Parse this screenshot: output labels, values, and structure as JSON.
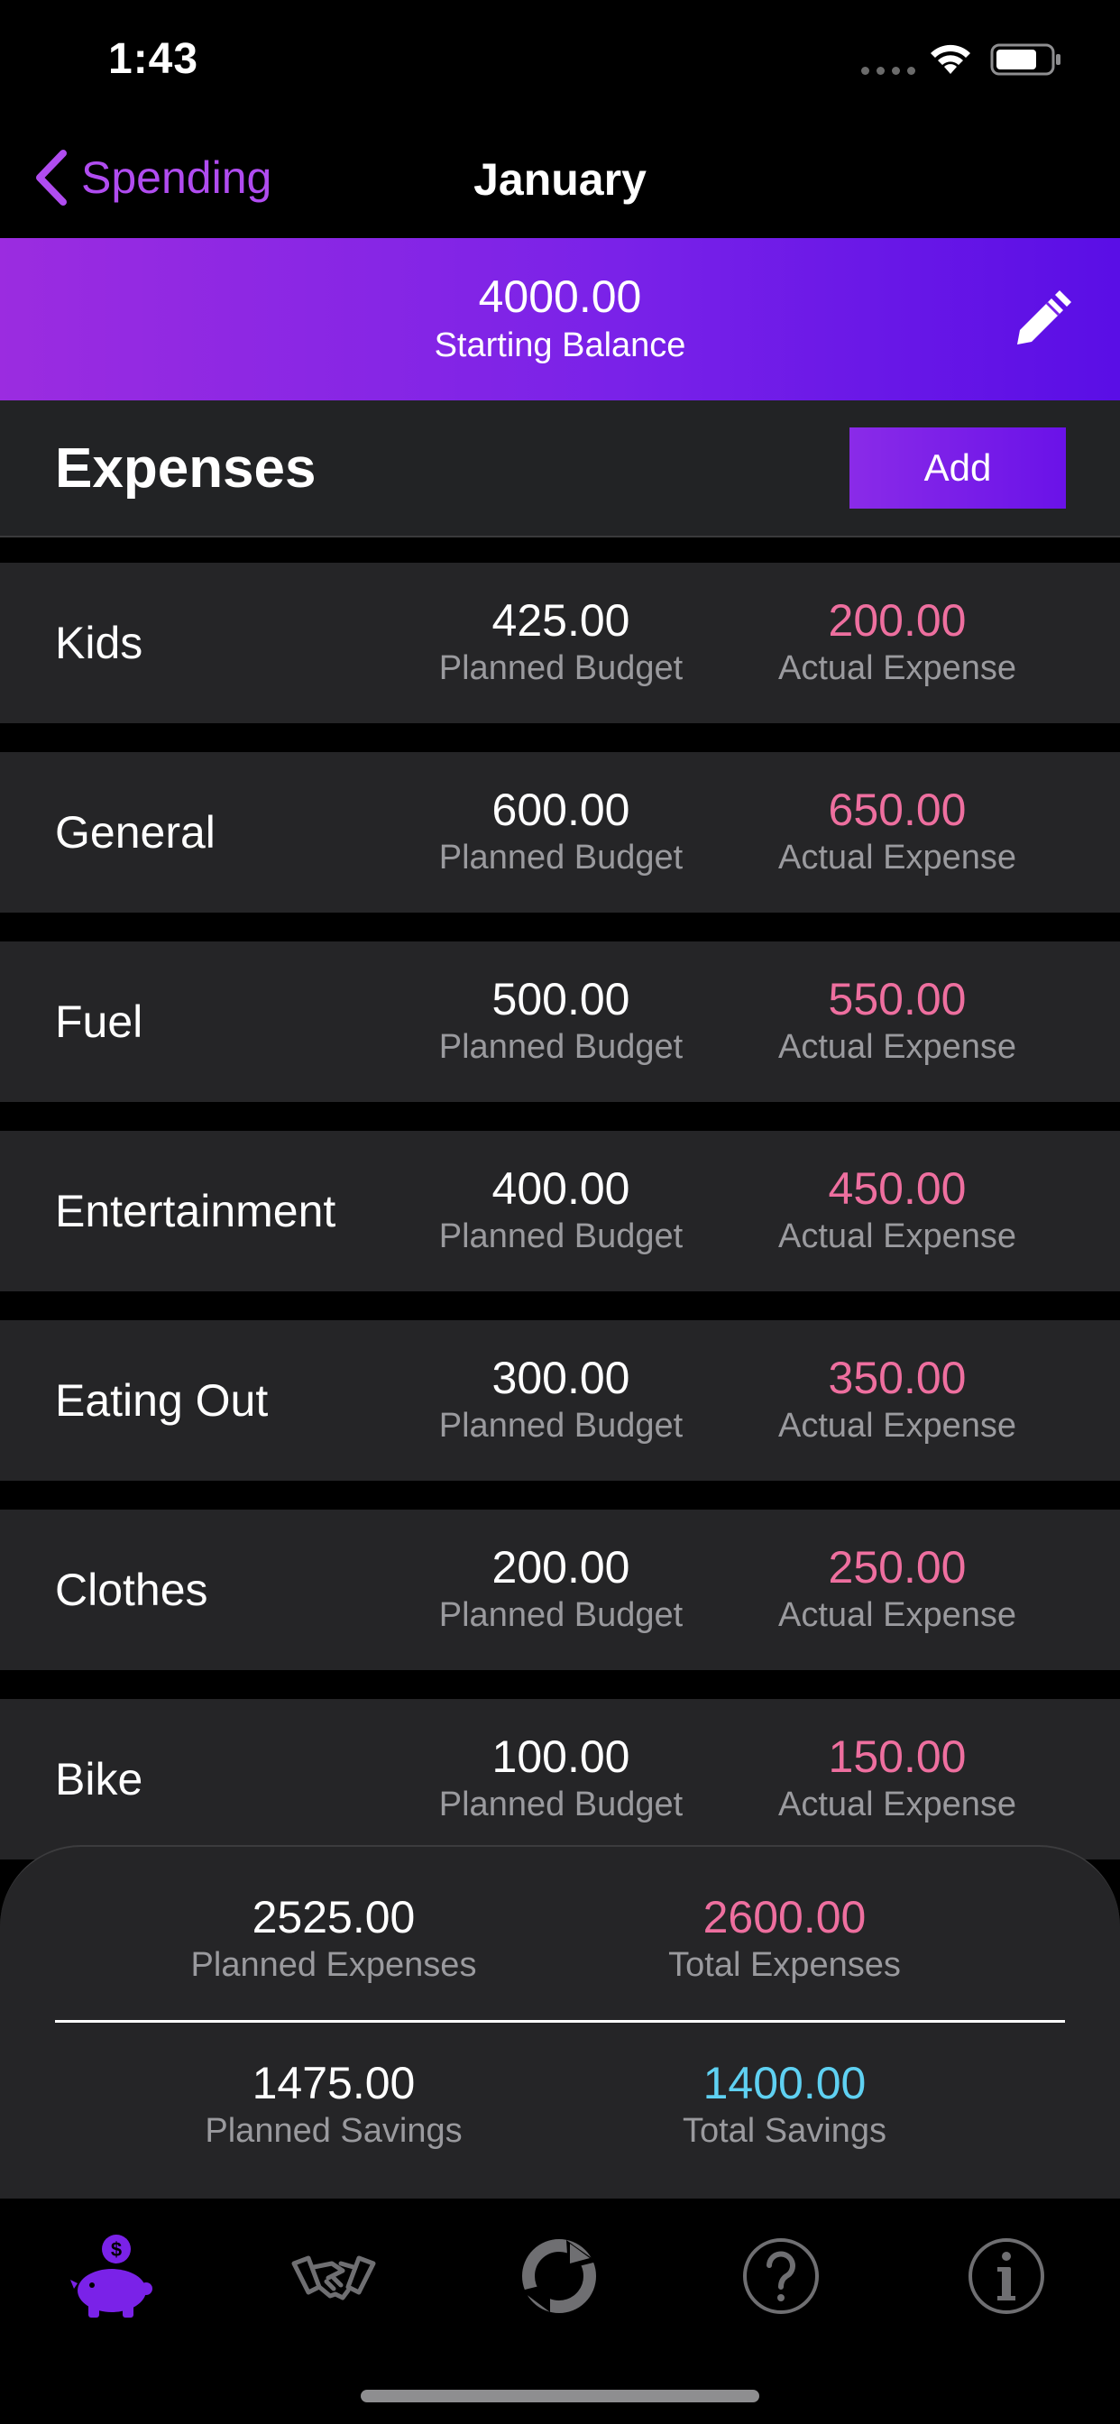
{
  "status_bar": {
    "time": "1:43"
  },
  "nav": {
    "back_label": "Spending",
    "title": "January"
  },
  "balance": {
    "value": "4000.00",
    "label": "Starting Balance"
  },
  "expenses": {
    "title": "Expenses",
    "add_label": "Add",
    "rows": [
      {
        "name": "Kids",
        "planned": "425.00",
        "planned_label": "Planned Budget",
        "actual": "200.00",
        "actual_label": "Actual Expense"
      },
      {
        "name": "General",
        "planned": "600.00",
        "planned_label": "Planned Budget",
        "actual": "650.00",
        "actual_label": "Actual Expense"
      },
      {
        "name": "Fuel",
        "planned": "500.00",
        "planned_label": "Planned Budget",
        "actual": "550.00",
        "actual_label": "Actual Expense"
      },
      {
        "name": "Entertainment",
        "planned": "400.00",
        "planned_label": "Planned Budget",
        "actual": "450.00",
        "actual_label": "Actual Expense"
      },
      {
        "name": "Eating Out",
        "planned": "300.00",
        "planned_label": "Planned Budget",
        "actual": "350.00",
        "actual_label": "Actual Expense"
      },
      {
        "name": "Clothes",
        "planned": "200.00",
        "planned_label": "Planned Budget",
        "actual": "250.00",
        "actual_label": "Actual Expense"
      },
      {
        "name": "Bike",
        "planned": "100.00",
        "planned_label": "Planned Budget",
        "actual": "150.00",
        "actual_label": "Actual Expense"
      }
    ]
  },
  "summary": {
    "planned_expenses": {
      "value": "2525.00",
      "label": "Planned Expenses"
    },
    "total_expenses": {
      "value": "2600.00",
      "label": "Total Expenses"
    },
    "planned_savings": {
      "value": "1475.00",
      "label": "Planned Savings"
    },
    "total_savings": {
      "value": "1400.00",
      "label": "Total Savings"
    }
  },
  "tabs": [
    {
      "icon": "piggy-bank-icon",
      "active": true
    },
    {
      "icon": "handshake-icon",
      "active": false
    },
    {
      "icon": "recycle-icon",
      "active": false
    },
    {
      "icon": "help-icon",
      "active": false
    },
    {
      "icon": "info-icon",
      "active": false
    }
  ],
  "colors": {
    "accent": "#b04cf0",
    "banner_start": "#9b2ce0",
    "banner_end": "#5a0ee6",
    "expense_pink": "#ee6f9f",
    "savings_cyan": "#5fd1f2",
    "row_bg": "#252527"
  }
}
